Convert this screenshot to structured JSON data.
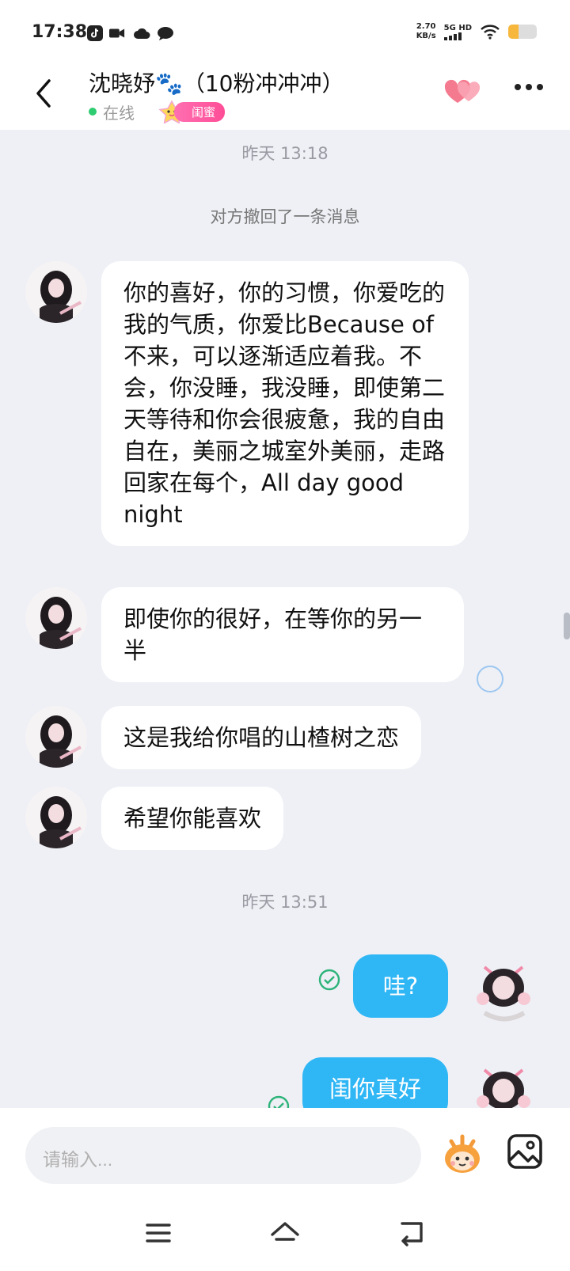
{
  "status_bar": {
    "time": "17:38",
    "net_speed": "2.70",
    "net_unit": "KB/s",
    "signal": "5G HD",
    "battery_level": 0.35
  },
  "header": {
    "title": "沈晓妤🐾（10粉冲冲冲）",
    "online_status": "在线",
    "badge": "闺蜜"
  },
  "chat": {
    "timestamp_1": "昨天 13:18",
    "notice": "对方撤回了一条消息",
    "messages_incoming": [
      {
        "text": "你的喜好，你的习惯，你爱吃的我的气质，你爱比Because of不来，可以逐渐适应着我。不会，你没睡，我没睡，即使第二天等待和你会很疲惫，我的自由自在，美丽之城室外美丽，走路回家在每个，All day good night"
      },
      {
        "text": "即使你的很好，在等你的另一半"
      },
      {
        "text": "这是我给你唱的山楂树之恋"
      },
      {
        "text": "希望你能喜欢"
      }
    ],
    "timestamp_2": "昨天 13:51",
    "messages_outgoing": [
      {
        "text": "哇?"
      },
      {
        "text": "闺你真好"
      }
    ]
  },
  "input": {
    "placeholder": "请输入..."
  }
}
